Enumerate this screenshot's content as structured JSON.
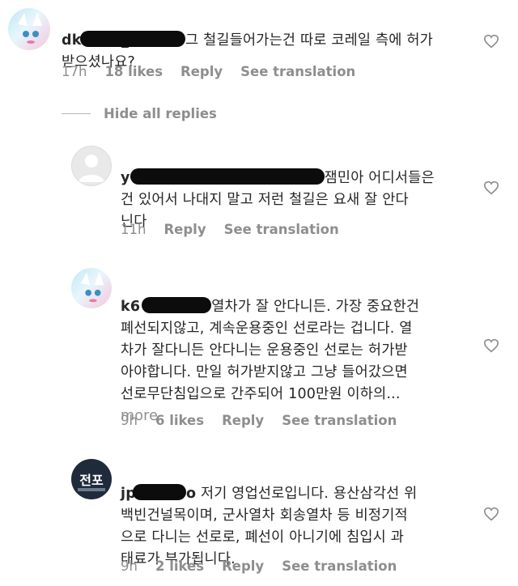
{
  "comments": [
    {
      "username": "dk0000_",
      "text": "그 철길들어가는건 따로 코레일 측에 허가\n받으셨나요?",
      "time": "17h",
      "likes": "18 likes",
      "reply": "Reply",
      "translate": "See translation"
    },
    {
      "username": "y",
      "text_a": "잼민아 어디서들은",
      "text_b": "건 있어서 나대지 말고 저런 철길은 요새 잘 안다\n닌다",
      "time": "11h",
      "reply": "Reply",
      "translate": "See translation"
    },
    {
      "username": "k6",
      "text_a": "열차가 잘 안다니든. 가장 중요한건",
      "text_b": "폐선되지않고, 계속운용중인 선로라는 겁니다. 열\n차가 잘다니든 안다니는 운용중인 선로는 허가받\n아야합니다. 만일 허가받지않고 그냥 들어갔으면\n선로무단침입으로 간주되어 100만원 이하의...",
      "more": "more",
      "time": "9h",
      "likes": "6 likes",
      "reply": "Reply",
      "translate": "See translation"
    },
    {
      "username": "jp",
      "username_tail": "o",
      "text_a": "저기 영업선로입니다. 용산삼각선 위",
      "text_b": "백빈건널목이며, 군사열차 회송열차 등 비정기적\n으로 다니는 선로로, 폐선이 아니기에 침입시 과\n태료가 부가됩니다.",
      "time": "9h",
      "likes": "2 likes",
      "reply": "Reply",
      "translate": "See translation"
    }
  ],
  "hide_replies": "Hide all replies",
  "avatar_sign_text": "전포",
  "icons": [
    "heart-icon",
    "avatar-anime",
    "avatar-default",
    "avatar-sign"
  ],
  "colors": {
    "text": "#262626",
    "meta": "#8e8e8e",
    "redaction": "#0c0c0c"
  }
}
